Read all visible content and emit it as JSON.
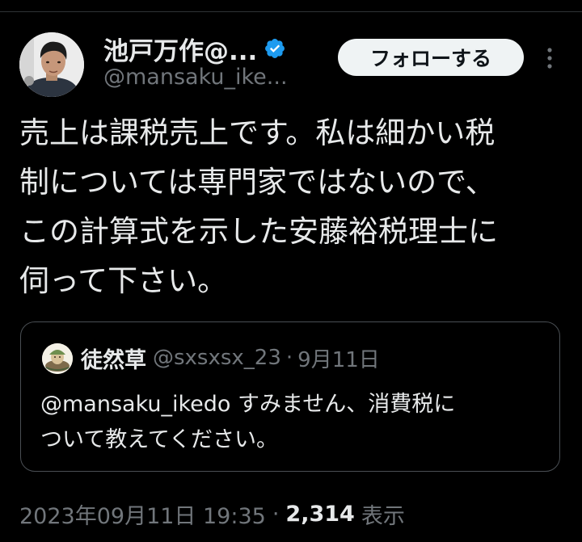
{
  "author": {
    "display_name": "池戸万作@...",
    "handle": "@mansaku_ike...",
    "verified": true
  },
  "follow_button": {
    "label": "フォローする"
  },
  "more_icon": "more-vertical-icon",
  "tweet": {
    "lines": [
      "売上は課税売上です。私は細かい税",
      "制については専門家ではないので、",
      "この計算式を示した安藤裕税理士に",
      "伺って下さい。"
    ]
  },
  "quoted": {
    "display_name": "徒然草",
    "handle": "@sxsxsx_23",
    "separator": "·",
    "date": "9月11日",
    "lines": [
      "@mansaku_ikedo すみません、消費税に",
      "ついて教えてください。"
    ]
  },
  "meta": {
    "timestamp": "2023年09月11日 19:35",
    "separator": "·",
    "views_count": "2,314",
    "views_label": "表示"
  },
  "colors": {
    "background": "#000000",
    "text_primary": "#e7e9ea",
    "text_secondary": "#71767b",
    "verified_blue": "#1d9bf0",
    "follow_button_bg": "#eff3f4",
    "border": "#4a4f54"
  }
}
